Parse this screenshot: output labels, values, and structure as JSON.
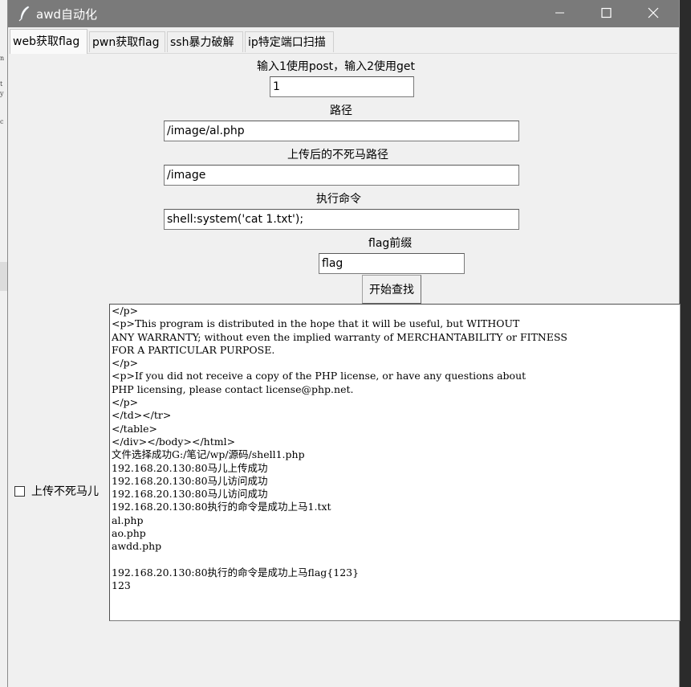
{
  "window": {
    "title": "awd自动化"
  },
  "tabs": [
    {
      "label": "web获取flag",
      "active": true
    },
    {
      "label": "pwn获取flag",
      "active": false
    },
    {
      "label": "ssh暴力破解",
      "active": false
    },
    {
      "label": "ip特定端口扫描",
      "active": false
    }
  ],
  "form": {
    "method_label": "输入1使用post，输入2使用get",
    "method_value": "1",
    "path_label": "路径",
    "path_value": "/image/al.php",
    "upload_path_label": "上传后的不死马路径",
    "upload_path_value": "/image",
    "command_label": "执行命令",
    "command_value": "shell:system('cat 1.txt');",
    "flag_prefix_label": "flag前缀",
    "flag_prefix_value": "flag",
    "start_button": "开始查找"
  },
  "checkbox": {
    "label": "上传不死马儿",
    "checked": false
  },
  "output_lines": [
    "</p>",
    "<p>This program is distributed in the hope that it will be useful, but WITHOUT",
    "ANY WARRANTY; without even the implied warranty of MERCHANTABILITY or FITNESS",
    "FOR A PARTICULAR PURPOSE.",
    "</p>",
    "<p>If you did not receive a copy of the PHP license, or have any questions about",
    "PHP licensing, please contact license@php.net.",
    "</p>",
    "</td></tr>",
    "</table>",
    "</div></body></html>",
    "文件选择成功G:/笔记/wp/源码/shell1.php",
    "192.168.20.130:80马儿上传成功",
    "192.168.20.130:80马儿访问成功",
    "192.168.20.130:80马儿访问成功",
    "192.168.20.130:80执行的命令是成功上马1.txt",
    "al.php",
    "ao.php",
    "awdd.php",
    "",
    "192.168.20.130:80执行的命令是成功上马flag{123}",
    "123"
  ],
  "colors": {
    "titlebar": "#7a7a7a",
    "window_bg": "#f0f0f0",
    "desktop": "#2b2b2b"
  },
  "icons": [
    "feather-app-icon",
    "minimize-icon",
    "maximize-icon",
    "close-icon",
    "checkbox-icon"
  ]
}
